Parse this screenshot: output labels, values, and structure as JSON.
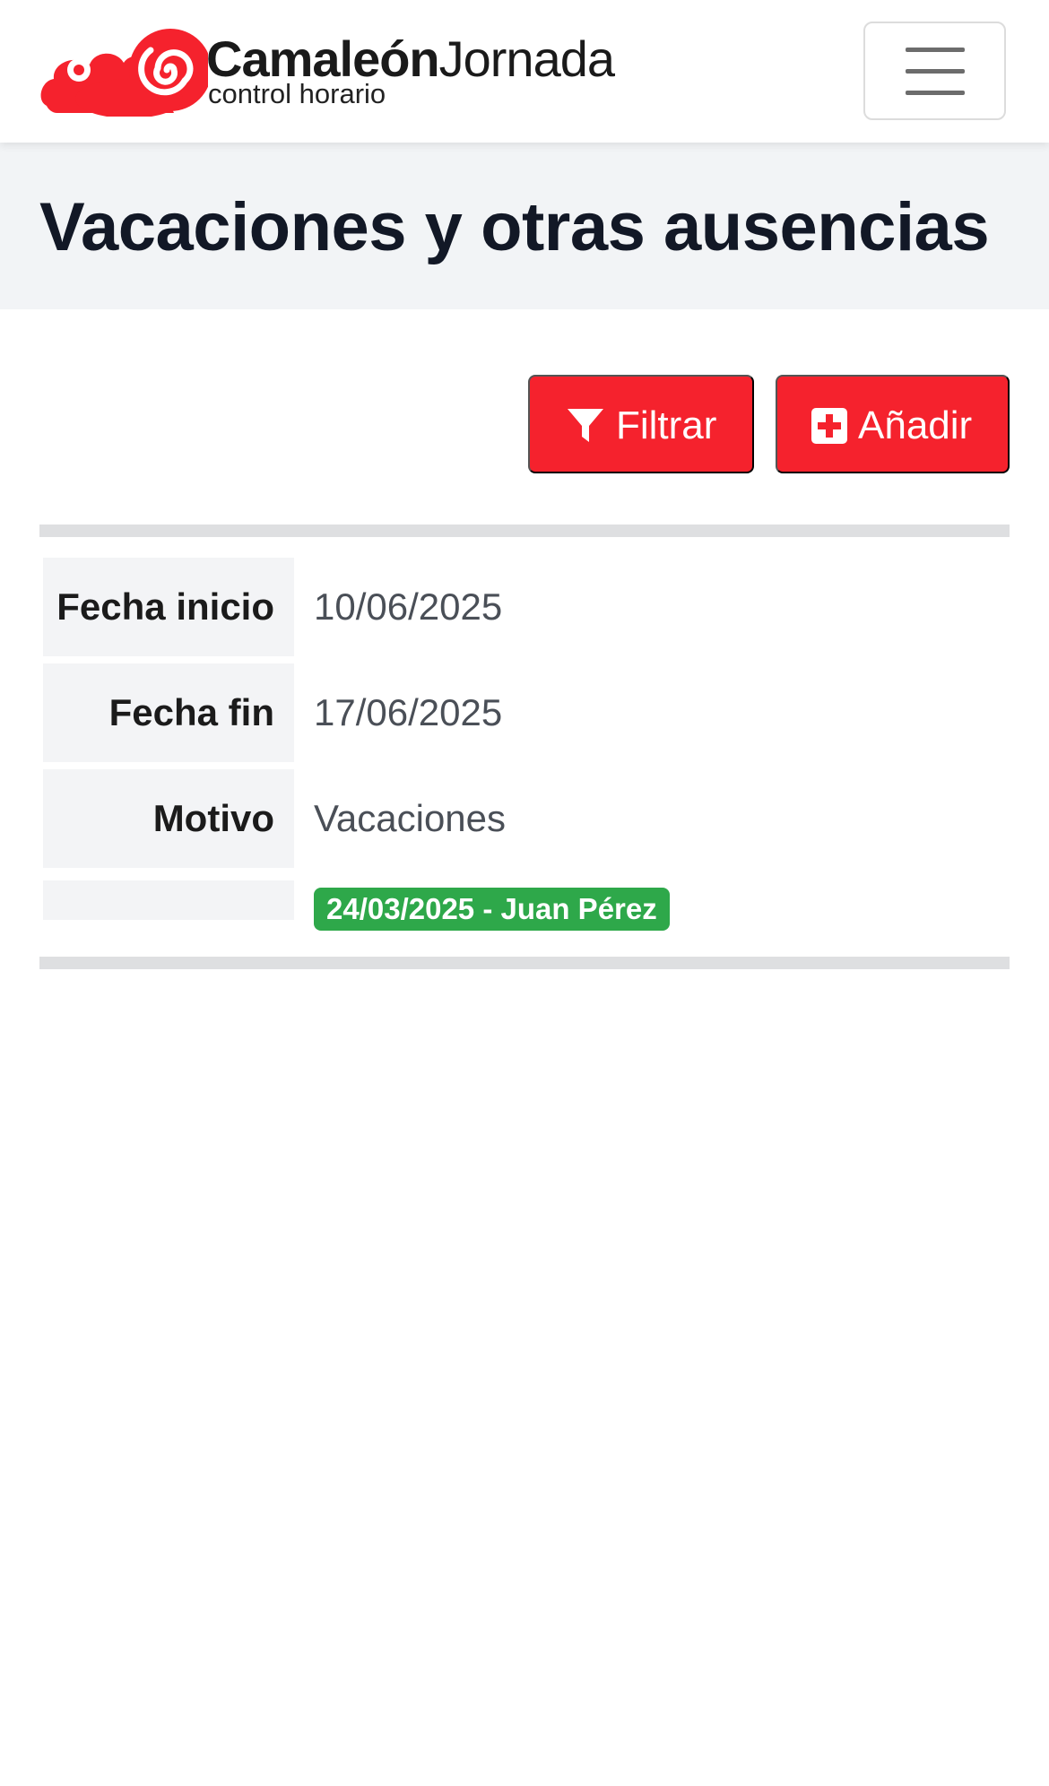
{
  "brand": {
    "name_bold": "Camaleón",
    "name_light": "Jornada",
    "tagline": "control horario",
    "logo_icon": "red-cloud-spiral-logo",
    "color": "#f5222d"
  },
  "nav": {
    "menu_icon": "hamburger-icon"
  },
  "page": {
    "title": "Vacaciones y otras ausencias"
  },
  "actions": {
    "filter_label": "Filtrar",
    "filter_icon": "filter-icon",
    "add_label": "Añadir",
    "add_icon": "plus-square-icon",
    "button_color": "#f5222d"
  },
  "record": {
    "rows": [
      {
        "label": "Fecha inicio",
        "value": "10/06/2025"
      },
      {
        "label": "Fecha fin",
        "value": "17/06/2025"
      },
      {
        "label": "Motivo",
        "value": "Vacaciones"
      }
    ],
    "badge": "24/03/2025 - Juan Pérez",
    "badge_color": "#2ea84a"
  }
}
